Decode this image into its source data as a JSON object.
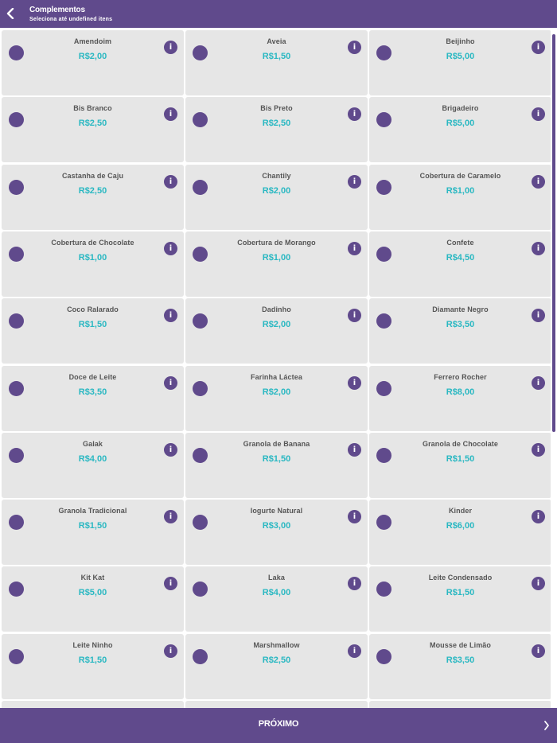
{
  "header": {
    "title": "Complementos",
    "subtitle": "Seleciona até undefined itens"
  },
  "items": [
    {
      "name": "Amendoim",
      "price": "R$2,00"
    },
    {
      "name": "Aveia",
      "price": "R$1,50"
    },
    {
      "name": "Beijinho",
      "price": "R$5,00"
    },
    {
      "name": "Bis Branco",
      "price": "R$2,50"
    },
    {
      "name": "Bis Preto",
      "price": "R$2,50"
    },
    {
      "name": "Brigadeiro",
      "price": "R$5,00"
    },
    {
      "name": "Castanha de Caju",
      "price": "R$2,50"
    },
    {
      "name": "Chantily",
      "price": "R$2,00"
    },
    {
      "name": "Cobertura de Caramelo",
      "price": "R$1,00"
    },
    {
      "name": "Cobertura de Chocolate",
      "price": "R$1,00"
    },
    {
      "name": "Cobertura de Morango",
      "price": "R$1,00"
    },
    {
      "name": "Confete",
      "price": "R$4,50"
    },
    {
      "name": "Coco Ralarado",
      "price": "R$1,50"
    },
    {
      "name": "Dadinho",
      "price": "R$2,00"
    },
    {
      "name": "Diamante Negro",
      "price": "R$3,50"
    },
    {
      "name": "Doce de Leite",
      "price": "R$3,50"
    },
    {
      "name": "Farinha Láctea",
      "price": "R$2,00"
    },
    {
      "name": "Ferrero Rocher",
      "price": "R$8,00"
    },
    {
      "name": "Galak",
      "price": "R$4,00"
    },
    {
      "name": "Granola de Banana",
      "price": "R$1,50"
    },
    {
      "name": "Granola de Chocolate",
      "price": "R$1,50"
    },
    {
      "name": "Granola Tradicional",
      "price": "R$1,50"
    },
    {
      "name": "Iogurte Natural",
      "price": "R$3,00"
    },
    {
      "name": "Kinder",
      "price": "R$6,00"
    },
    {
      "name": "Kit Kat",
      "price": "R$5,00"
    },
    {
      "name": "Laka",
      "price": "R$4,00"
    },
    {
      "name": "Leite Condensado",
      "price": "R$1,50"
    },
    {
      "name": "Leite Ninho",
      "price": "R$1,50"
    },
    {
      "name": "Marshmallow",
      "price": "R$2,50"
    },
    {
      "name": "Mousse de Limão",
      "price": "R$3,50"
    },
    {
      "name": "",
      "price": ""
    },
    {
      "name": "",
      "price": ""
    },
    {
      "name": "",
      "price": ""
    }
  ],
  "info_glyph": "i",
  "footer": {
    "next_label": "PRÓXIMO"
  },
  "colors": {
    "primary": "#604a8c",
    "price": "#2ab8c2",
    "card_bg": "#e6e6e6",
    "text": "#555555"
  }
}
